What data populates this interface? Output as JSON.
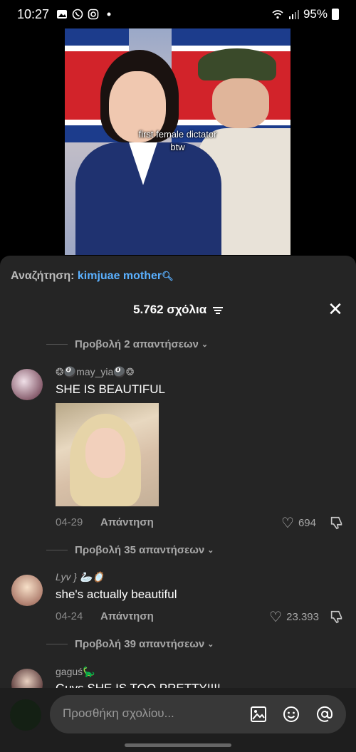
{
  "status_bar": {
    "time": "10:27",
    "battery": "95%",
    "left_icons": [
      "gallery-icon",
      "whatsapp-icon",
      "instagram-icon",
      "dot-icon"
    ],
    "right_icons": [
      "wifi-icon",
      "signal-icon",
      "battery-icon"
    ]
  },
  "video": {
    "caption_line1": "first female dictator",
    "caption_line2": "btw"
  },
  "search": {
    "label": "Αναζήτηση:",
    "term": "kimjuae mother"
  },
  "header": {
    "title": "5.762 σχόλια"
  },
  "comments": [
    {
      "replies_label": "Προβολή 2 απαντήσεων",
      "username": "❂🎱may_yia🎱❂",
      "text": "SHE IS BEAUTIFUL",
      "date": "04-29",
      "reply": "Απάντηση",
      "likes": "694"
    },
    {
      "replies_label": "Προβολή 35 απαντήσεων",
      "username": "Lyv } 🦢🪞",
      "text": "she's actually beautiful",
      "date": "04-24",
      "reply": "Απάντηση",
      "likes": "23.393"
    },
    {
      "replies_label": "Προβολή 39 απαντήσεων",
      "username": "gaguś🦕",
      "text": "Guys SHE IS TOO PRETTY!!!!"
    }
  ],
  "composer": {
    "placeholder": "Προσθήκη σχολίου..."
  }
}
